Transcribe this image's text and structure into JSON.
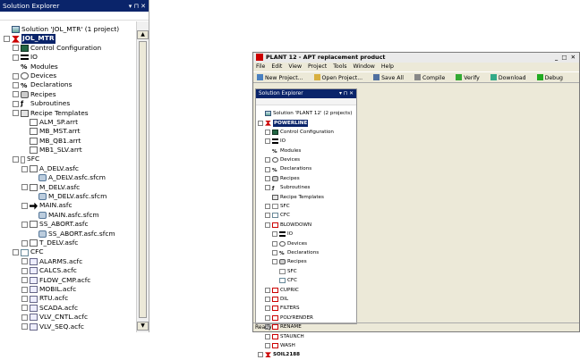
{
  "left": {
    "title": "Solution Explorer",
    "pin": "▾ ⊓ ✕",
    "tree": [
      {
        "lvl": 0,
        "exp": "",
        "icon": "solution",
        "label": "Solution 'JOL_MTR' (1 project)"
      },
      {
        "lvl": 0,
        "exp": "−",
        "icon": "project",
        "label": "JOL_MTR",
        "selected": true
      },
      {
        "lvl": 1,
        "exp": "+",
        "icon": "control",
        "label": "Control Configuration"
      },
      {
        "lvl": 1,
        "exp": "+",
        "icon": "io",
        "label": "IO"
      },
      {
        "lvl": 1,
        "exp": "",
        "icon": "modules",
        "label": "Modules"
      },
      {
        "lvl": 1,
        "exp": "+",
        "icon": "devices",
        "label": "Devices"
      },
      {
        "lvl": 1,
        "exp": "+",
        "icon": "decl",
        "label": "Declarations"
      },
      {
        "lvl": 1,
        "exp": "+",
        "icon": "recipes",
        "label": "Recipes"
      },
      {
        "lvl": 1,
        "exp": "+",
        "icon": "subs",
        "label": "Subroutines"
      },
      {
        "lvl": 1,
        "exp": "−",
        "icon": "templates",
        "label": "Recipe Templates"
      },
      {
        "lvl": 2,
        "exp": "",
        "icon": "file",
        "label": "ALM_SP.arrt"
      },
      {
        "lvl": 2,
        "exp": "",
        "icon": "file",
        "label": "MB_MST.arrt"
      },
      {
        "lvl": 2,
        "exp": "",
        "icon": "file",
        "label": "MB_QB1.arrt"
      },
      {
        "lvl": 2,
        "exp": "",
        "icon": "file",
        "label": "MB1_SLV.arrt"
      },
      {
        "lvl": 1,
        "exp": "−",
        "icon": "sfc",
        "label": "SFC"
      },
      {
        "lvl": 2,
        "exp": "−",
        "icon": "file",
        "label": "A_DELV.asfc"
      },
      {
        "lvl": 3,
        "exp": "",
        "icon": "sfcm",
        "label": "A_DELV.asfc.sfcm"
      },
      {
        "lvl": 2,
        "exp": "−",
        "icon": "file",
        "label": "M_DELV.asfc"
      },
      {
        "lvl": 3,
        "exp": "",
        "icon": "sfcm",
        "label": "M_DELV.asfc.sfcm"
      },
      {
        "lvl": 2,
        "exp": "−",
        "icon": "arrow",
        "label": "MAIN.asfc"
      },
      {
        "lvl": 3,
        "exp": "",
        "icon": "sfcm",
        "label": "MAIN.asfc.sfcm"
      },
      {
        "lvl": 2,
        "exp": "−",
        "icon": "file",
        "label": "SS_ABORT.asfc"
      },
      {
        "lvl": 3,
        "exp": "",
        "icon": "sfcm",
        "label": "SS_ABORT.asfc.sfcm"
      },
      {
        "lvl": 2,
        "exp": "+",
        "icon": "file",
        "label": "T_DELV.asfc"
      },
      {
        "lvl": 1,
        "exp": "−",
        "icon": "cfc",
        "label": "CFC"
      },
      {
        "lvl": 2,
        "exp": "+",
        "icon": "cfcfile",
        "label": "ALARMS.acfc"
      },
      {
        "lvl": 2,
        "exp": "+",
        "icon": "cfcfile",
        "label": "CALCS.acfc"
      },
      {
        "lvl": 2,
        "exp": "+",
        "icon": "cfcfile",
        "label": "FLOW_CMP.acfc"
      },
      {
        "lvl": 2,
        "exp": "+",
        "icon": "cfcfile",
        "label": "MOBIL.acfc"
      },
      {
        "lvl": 2,
        "exp": "+",
        "icon": "cfcfile",
        "label": "RTU.acfc"
      },
      {
        "lvl": 2,
        "exp": "+",
        "icon": "cfcfile",
        "label": "SCADA.acfc"
      },
      {
        "lvl": 2,
        "exp": "+",
        "icon": "cfcfile",
        "label": "VLV_CNTL.acfc"
      },
      {
        "lvl": 2,
        "exp": "+",
        "icon": "cfcfile",
        "label": "VLV_SEQ.acfc"
      }
    ]
  },
  "right": {
    "window_title": "PLANT 12 - APT replacement product",
    "window_controls": "_ □ ✕",
    "menu": [
      "File",
      "Edit",
      "View",
      "Project",
      "Tools",
      "Window",
      "Help"
    ],
    "toolbar": [
      "New Project...",
      "Open Project...",
      "Save All",
      "Compile",
      "Verify",
      "Download",
      "Debug"
    ],
    "pane_title": "Solution Explorer",
    "pin": "▾ ⊓ ✕",
    "status": "Ready",
    "tree": [
      {
        "lvl": 0,
        "exp": "",
        "icon": "solution",
        "label": "Solution 'PLANT 12' (2 projects)"
      },
      {
        "lvl": 0,
        "exp": "−",
        "icon": "project",
        "label": "POWERLINE",
        "selected": true
      },
      {
        "lvl": 1,
        "exp": "+",
        "icon": "control",
        "label": "Control Configuration"
      },
      {
        "lvl": 1,
        "exp": "+",
        "icon": "io",
        "label": "IO"
      },
      {
        "lvl": 1,
        "exp": "",
        "icon": "modules",
        "label": "Modules"
      },
      {
        "lvl": 1,
        "exp": "+",
        "icon": "devices",
        "label": "Devices"
      },
      {
        "lvl": 1,
        "exp": "+",
        "icon": "decl",
        "label": "Declarations"
      },
      {
        "lvl": 1,
        "exp": "+",
        "icon": "recipes",
        "label": "Recipes"
      },
      {
        "lvl": 1,
        "exp": "+",
        "icon": "subs",
        "label": "Subroutines"
      },
      {
        "lvl": 1,
        "exp": "",
        "icon": "templates",
        "label": "Recipe Templates"
      },
      {
        "lvl": 1,
        "exp": "+",
        "icon": "sfc",
        "label": "SFC"
      },
      {
        "lvl": 1,
        "exp": "+",
        "icon": "cfc",
        "label": "CFC"
      },
      {
        "lvl": 1,
        "exp": "−",
        "icon": "unit",
        "label": "BLOWDOWN"
      },
      {
        "lvl": 2,
        "exp": "+",
        "icon": "io",
        "label": "IO"
      },
      {
        "lvl": 2,
        "exp": "+",
        "icon": "devices",
        "label": "Devices"
      },
      {
        "lvl": 2,
        "exp": "+",
        "icon": "decl",
        "label": "Declarations"
      },
      {
        "lvl": 2,
        "exp": "+",
        "icon": "recipes",
        "label": "Recipes"
      },
      {
        "lvl": 2,
        "exp": "",
        "icon": "sfc",
        "label": "SFC"
      },
      {
        "lvl": 2,
        "exp": "",
        "icon": "cfc",
        "label": "CFC"
      },
      {
        "lvl": 1,
        "exp": "+",
        "icon": "unit",
        "label": "CUPRIC"
      },
      {
        "lvl": 1,
        "exp": "+",
        "icon": "unit",
        "label": "DIL"
      },
      {
        "lvl": 1,
        "exp": "+",
        "icon": "unit",
        "label": "FILTERS"
      },
      {
        "lvl": 1,
        "exp": "+",
        "icon": "unit",
        "label": "POLYRENDER"
      },
      {
        "lvl": 1,
        "exp": "+",
        "icon": "unit",
        "label": "RENAME"
      },
      {
        "lvl": 1,
        "exp": "+",
        "icon": "unit",
        "label": "STAUNCH"
      },
      {
        "lvl": 1,
        "exp": "+",
        "icon": "unit",
        "label": "WASH"
      },
      {
        "lvl": 0,
        "exp": "+",
        "icon": "project",
        "label": "SOIL2188",
        "bold": true
      }
    ]
  }
}
